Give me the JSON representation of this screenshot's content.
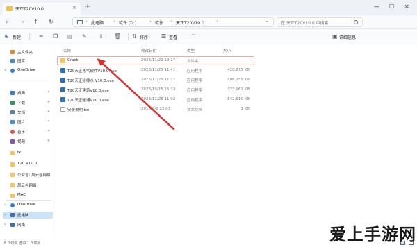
{
  "window": {
    "tab_title": "天正T20V10.0",
    "close_tab": "×",
    "new_tab": "+",
    "minimize": "—",
    "maximize": "☐",
    "close": "✕"
  },
  "address": {
    "back": "←",
    "forward": "→",
    "up": "↑",
    "refresh": "↻",
    "breadcrumbs": [
      "此电脑",
      "软件 (D:)",
      "软件",
      "天正T20V10.0"
    ],
    "separator": "›",
    "more": "⌄",
    "search_placeholder": "在 天正T20V10.0 中搜索"
  },
  "toolbar": {
    "new_label": "新建",
    "new_icon": "⊕",
    "sort_label": "排序",
    "view_label": "查看",
    "more_label": "···",
    "details_label": "详细信息",
    "icons": [
      "cut-icon",
      "copy-icon",
      "paste-icon",
      "rename-icon",
      "share-icon",
      "delete-icon"
    ]
  },
  "sidebar": {
    "items": [
      {
        "label": "主文件夹",
        "icon": "home-icon",
        "color": "#e0883a",
        "chevron": "",
        "pin": false
      },
      {
        "label": "图库",
        "icon": "gallery-icon",
        "color": "#3a86c8",
        "chevron": "",
        "pin": false
      },
      {
        "label": "OneDrive",
        "icon": "cloud-icon",
        "color": "#2b7bd0",
        "chevron": "›",
        "pin": false
      },
      {
        "label": "桌面",
        "icon": "desktop-icon",
        "color": "#2f7fd2",
        "chevron": "",
        "pin": true
      },
      {
        "label": "下载",
        "icon": "download-icon",
        "color": "#2f9b5a",
        "chevron": "",
        "pin": true
      },
      {
        "label": "文档",
        "icon": "document-icon",
        "color": "#5f7fa8",
        "chevron": "",
        "pin": true
      },
      {
        "label": "图片",
        "icon": "pictures-icon",
        "color": "#3b8fd5",
        "chevron": "",
        "pin": true
      },
      {
        "label": "音乐",
        "icon": "music-icon",
        "color": "#d45a4a",
        "chevron": "",
        "pin": true
      },
      {
        "label": "视频",
        "icon": "video-icon",
        "color": "#8a4fc8",
        "chevron": "",
        "pin": true
      },
      {
        "label": "fx",
        "icon": "folder-icon",
        "color": "#f4c65a",
        "chevron": "",
        "pin": false
      },
      {
        "label": "T20 V10.0",
        "icon": "folder-icon",
        "color": "#f4c65a",
        "chevron": "",
        "pin": false
      },
      {
        "label": "公众号: 风云谷网络",
        "icon": "folder-icon",
        "color": "#f4c65a",
        "chevron": "",
        "pin": false
      },
      {
        "label": "风云谷网络",
        "icon": "folder-icon",
        "color": "#f4c65a",
        "chevron": "",
        "pin": false
      },
      {
        "label": "MAC",
        "icon": "folder-icon",
        "color": "#f4c65a",
        "chevron": "",
        "pin": false
      },
      {
        "label": "OneDrive",
        "icon": "cloud-icon",
        "color": "#2b7bd0",
        "chevron": "›",
        "pin": false
      },
      {
        "label": "此电脑",
        "icon": "pc-icon",
        "color": "#3d6fa8",
        "chevron": "›",
        "pin": false
      },
      {
        "label": "网络",
        "icon": "network-icon",
        "color": "#3d6fa8",
        "chevron": "›",
        "pin": false
      }
    ]
  },
  "files": {
    "headers": {
      "name": "名称",
      "date": "修改日期",
      "type": "类型",
      "size": "大小"
    },
    "rows": [
      {
        "name": "Crack",
        "date": "2023/11/29 19:27",
        "type": "文件夹",
        "size": "",
        "kind": "folder"
      },
      {
        "name": "T20天正电气软件V10.0.exe",
        "date": "2023/11/25 11:41",
        "type": "应用程序",
        "size": "420,875 KB",
        "kind": "exe"
      },
      {
        "name": "T20天正给排水 V10.0.exe",
        "date": "2023/11/25 11:17",
        "type": "应用程序",
        "size": "506,255 KB",
        "kind": "exe"
      },
      {
        "name": "T20天正建筑V10.0.exe",
        "date": "2023/10/15 15:33",
        "type": "应用程序",
        "size": "323,961 KB",
        "kind": "exe"
      },
      {
        "name": "T20天正暖通V10.0.exe",
        "date": "2023/11/25 11:02",
        "type": "应用程序",
        "size": "642,610 KB",
        "kind": "exe"
      },
      {
        "name": "安装说明.txt",
        "date": "2018/6/2 22:03",
        "type": "文本文档",
        "size": "1 KB",
        "kind": "txt"
      }
    ]
  },
  "status": {
    "text": "6 个项目  选中 1 个项目"
  },
  "annotation": {
    "arrow_color": "#d9302c"
  },
  "watermark": {
    "text": "爱上手游网"
  }
}
